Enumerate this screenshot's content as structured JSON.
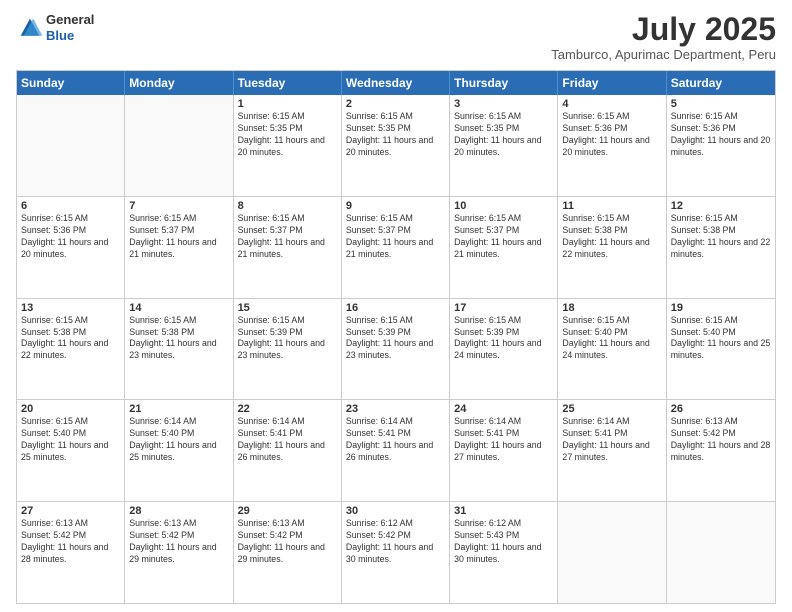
{
  "logo": {
    "line1": "General",
    "line2": "Blue"
  },
  "title": "July 2025",
  "subtitle": "Tamburco, Apurimac Department, Peru",
  "header_days": [
    "Sunday",
    "Monday",
    "Tuesday",
    "Wednesday",
    "Thursday",
    "Friday",
    "Saturday"
  ],
  "weeks": [
    [
      {
        "day": "",
        "sunrise": "",
        "sunset": "",
        "daylight": ""
      },
      {
        "day": "",
        "sunrise": "",
        "sunset": "",
        "daylight": ""
      },
      {
        "day": "1",
        "sunrise": "Sunrise: 6:15 AM",
        "sunset": "Sunset: 5:35 PM",
        "daylight": "Daylight: 11 hours and 20 minutes."
      },
      {
        "day": "2",
        "sunrise": "Sunrise: 6:15 AM",
        "sunset": "Sunset: 5:35 PM",
        "daylight": "Daylight: 11 hours and 20 minutes."
      },
      {
        "day": "3",
        "sunrise": "Sunrise: 6:15 AM",
        "sunset": "Sunset: 5:35 PM",
        "daylight": "Daylight: 11 hours and 20 minutes."
      },
      {
        "day": "4",
        "sunrise": "Sunrise: 6:15 AM",
        "sunset": "Sunset: 5:36 PM",
        "daylight": "Daylight: 11 hours and 20 minutes."
      },
      {
        "day": "5",
        "sunrise": "Sunrise: 6:15 AM",
        "sunset": "Sunset: 5:36 PM",
        "daylight": "Daylight: 11 hours and 20 minutes."
      }
    ],
    [
      {
        "day": "6",
        "sunrise": "Sunrise: 6:15 AM",
        "sunset": "Sunset: 5:36 PM",
        "daylight": "Daylight: 11 hours and 20 minutes."
      },
      {
        "day": "7",
        "sunrise": "Sunrise: 6:15 AM",
        "sunset": "Sunset: 5:37 PM",
        "daylight": "Daylight: 11 hours and 21 minutes."
      },
      {
        "day": "8",
        "sunrise": "Sunrise: 6:15 AM",
        "sunset": "Sunset: 5:37 PM",
        "daylight": "Daylight: 11 hours and 21 minutes."
      },
      {
        "day": "9",
        "sunrise": "Sunrise: 6:15 AM",
        "sunset": "Sunset: 5:37 PM",
        "daylight": "Daylight: 11 hours and 21 minutes."
      },
      {
        "day": "10",
        "sunrise": "Sunrise: 6:15 AM",
        "sunset": "Sunset: 5:37 PM",
        "daylight": "Daylight: 11 hours and 21 minutes."
      },
      {
        "day": "11",
        "sunrise": "Sunrise: 6:15 AM",
        "sunset": "Sunset: 5:38 PM",
        "daylight": "Daylight: 11 hours and 22 minutes."
      },
      {
        "day": "12",
        "sunrise": "Sunrise: 6:15 AM",
        "sunset": "Sunset: 5:38 PM",
        "daylight": "Daylight: 11 hours and 22 minutes."
      }
    ],
    [
      {
        "day": "13",
        "sunrise": "Sunrise: 6:15 AM",
        "sunset": "Sunset: 5:38 PM",
        "daylight": "Daylight: 11 hours and 22 minutes."
      },
      {
        "day": "14",
        "sunrise": "Sunrise: 6:15 AM",
        "sunset": "Sunset: 5:38 PM",
        "daylight": "Daylight: 11 hours and 23 minutes."
      },
      {
        "day": "15",
        "sunrise": "Sunrise: 6:15 AM",
        "sunset": "Sunset: 5:39 PM",
        "daylight": "Daylight: 11 hours and 23 minutes."
      },
      {
        "day": "16",
        "sunrise": "Sunrise: 6:15 AM",
        "sunset": "Sunset: 5:39 PM",
        "daylight": "Daylight: 11 hours and 23 minutes."
      },
      {
        "day": "17",
        "sunrise": "Sunrise: 6:15 AM",
        "sunset": "Sunset: 5:39 PM",
        "daylight": "Daylight: 11 hours and 24 minutes."
      },
      {
        "day": "18",
        "sunrise": "Sunrise: 6:15 AM",
        "sunset": "Sunset: 5:40 PM",
        "daylight": "Daylight: 11 hours and 24 minutes."
      },
      {
        "day": "19",
        "sunrise": "Sunrise: 6:15 AM",
        "sunset": "Sunset: 5:40 PM",
        "daylight": "Daylight: 11 hours and 25 minutes."
      }
    ],
    [
      {
        "day": "20",
        "sunrise": "Sunrise: 6:15 AM",
        "sunset": "Sunset: 5:40 PM",
        "daylight": "Daylight: 11 hours and 25 minutes."
      },
      {
        "day": "21",
        "sunrise": "Sunrise: 6:14 AM",
        "sunset": "Sunset: 5:40 PM",
        "daylight": "Daylight: 11 hours and 25 minutes."
      },
      {
        "day": "22",
        "sunrise": "Sunrise: 6:14 AM",
        "sunset": "Sunset: 5:41 PM",
        "daylight": "Daylight: 11 hours and 26 minutes."
      },
      {
        "day": "23",
        "sunrise": "Sunrise: 6:14 AM",
        "sunset": "Sunset: 5:41 PM",
        "daylight": "Daylight: 11 hours and 26 minutes."
      },
      {
        "day": "24",
        "sunrise": "Sunrise: 6:14 AM",
        "sunset": "Sunset: 5:41 PM",
        "daylight": "Daylight: 11 hours and 27 minutes."
      },
      {
        "day": "25",
        "sunrise": "Sunrise: 6:14 AM",
        "sunset": "Sunset: 5:41 PM",
        "daylight": "Daylight: 11 hours and 27 minutes."
      },
      {
        "day": "26",
        "sunrise": "Sunrise: 6:13 AM",
        "sunset": "Sunset: 5:42 PM",
        "daylight": "Daylight: 11 hours and 28 minutes."
      }
    ],
    [
      {
        "day": "27",
        "sunrise": "Sunrise: 6:13 AM",
        "sunset": "Sunset: 5:42 PM",
        "daylight": "Daylight: 11 hours and 28 minutes."
      },
      {
        "day": "28",
        "sunrise": "Sunrise: 6:13 AM",
        "sunset": "Sunset: 5:42 PM",
        "daylight": "Daylight: 11 hours and 29 minutes."
      },
      {
        "day": "29",
        "sunrise": "Sunrise: 6:13 AM",
        "sunset": "Sunset: 5:42 PM",
        "daylight": "Daylight: 11 hours and 29 minutes."
      },
      {
        "day": "30",
        "sunrise": "Sunrise: 6:12 AM",
        "sunset": "Sunset: 5:42 PM",
        "daylight": "Daylight: 11 hours and 30 minutes."
      },
      {
        "day": "31",
        "sunrise": "Sunrise: 6:12 AM",
        "sunset": "Sunset: 5:43 PM",
        "daylight": "Daylight: 11 hours and 30 minutes."
      },
      {
        "day": "",
        "sunrise": "",
        "sunset": "",
        "daylight": ""
      },
      {
        "day": "",
        "sunrise": "",
        "sunset": "",
        "daylight": ""
      }
    ]
  ]
}
